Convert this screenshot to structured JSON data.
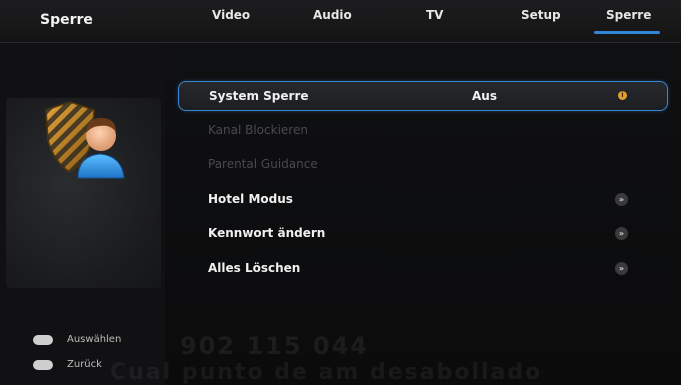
{
  "header": {
    "screen_title": "Sperre",
    "tabs": [
      {
        "label": "Video"
      },
      {
        "label": "Audio"
      },
      {
        "label": "TV"
      },
      {
        "label": "Setup"
      },
      {
        "label": "Sperre",
        "active": true
      }
    ]
  },
  "menu": {
    "items": [
      {
        "label": "System Sperre",
        "value": "Aus",
        "state": "selected",
        "icon": "info-icon"
      },
      {
        "label": "Kanal Blockieren",
        "state": "disabled"
      },
      {
        "label": "Parental Guidance",
        "state": "disabled"
      },
      {
        "label": "Hotel Modus",
        "icon": "chevron-right-icon"
      },
      {
        "label": "Kennwort ändern",
        "icon": "chevron-right-icon"
      },
      {
        "label": "Alles Löschen",
        "icon": "chevron-right-icon"
      }
    ]
  },
  "footer": {
    "select_hint": "Auswählen",
    "back_hint": "Zurück"
  },
  "watermark": {
    "line1": "902 115 044",
    "line2": "Cual punto de am desabollado"
  },
  "colors": {
    "accent": "#2f86d6",
    "background": "#0b0b0c",
    "info": "#e0a030"
  }
}
